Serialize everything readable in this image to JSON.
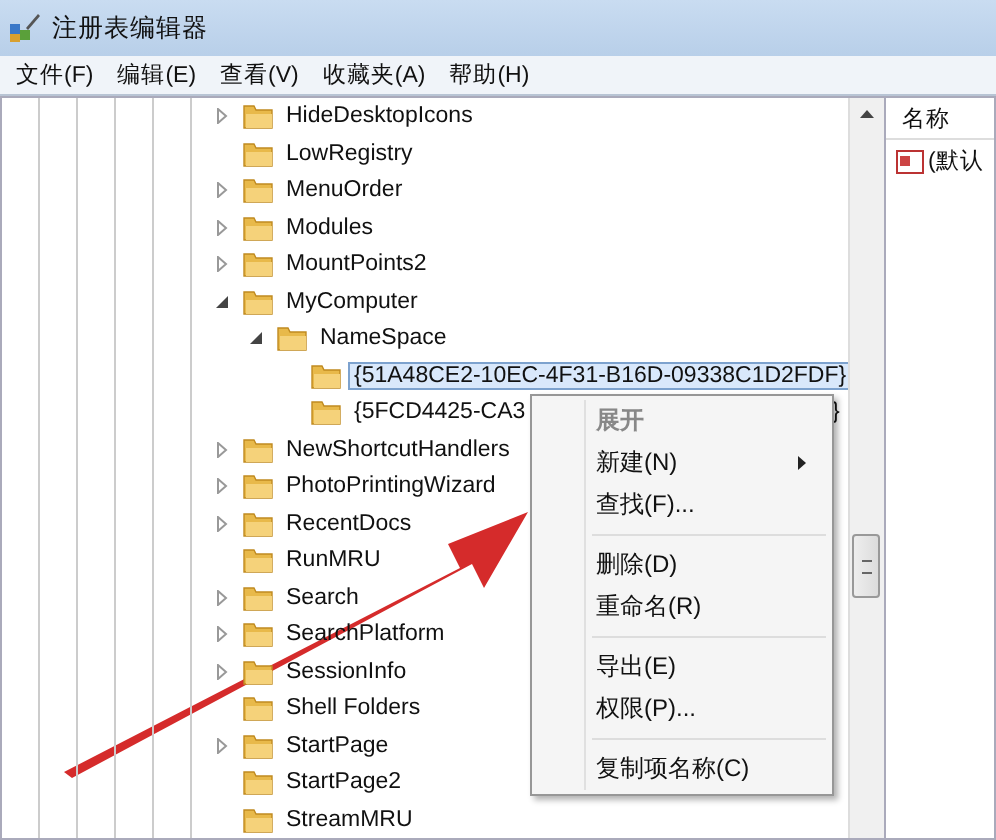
{
  "window": {
    "title": "注册表编辑器"
  },
  "menu_bar": [
    "文件(F)",
    "编辑(E)",
    "查看(V)",
    "收藏夹(A)",
    "帮助(H)"
  ],
  "tree": [
    {
      "label": "HideDesktopIcons",
      "expandable": true,
      "expanded": false,
      "selected": false
    },
    {
      "label": "LowRegistry",
      "expandable": false,
      "selected": false
    },
    {
      "label": "MenuOrder",
      "expandable": true,
      "expanded": false,
      "selected": false
    },
    {
      "label": "Modules",
      "expandable": true,
      "expanded": false,
      "selected": false
    },
    {
      "label": "MountPoints2",
      "expandable": true,
      "expanded": false,
      "selected": false
    },
    {
      "label": "MyComputer",
      "expandable": true,
      "expanded": true,
      "selected": false,
      "children": [
        {
          "label": "NameSpace",
          "expandable": true,
          "expanded": true,
          "selected": false,
          "children": [
            {
              "label": "{51A48CE2-10EC-4F31-B16D-09338C1D2FDF}",
              "expandable": false,
              "selected": true
            },
            {
              "label": "{5FCD4425-CA3",
              "tail": "}",
              "expandable": false,
              "selected": false
            }
          ]
        }
      ]
    },
    {
      "label": "NewShortcutHandlers",
      "expandable": true,
      "expanded": false,
      "selected": false
    },
    {
      "label": "PhotoPrintingWizard",
      "expandable": true,
      "expanded": false,
      "selected": false
    },
    {
      "label": "RecentDocs",
      "expandable": true,
      "expanded": false,
      "selected": false
    },
    {
      "label": "RunMRU",
      "expandable": false,
      "selected": false
    },
    {
      "label": "Search",
      "expandable": true,
      "expanded": false,
      "selected": false
    },
    {
      "label": "SearchPlatform",
      "expandable": true,
      "expanded": false,
      "selected": false
    },
    {
      "label": "SessionInfo",
      "expandable": true,
      "expanded": false,
      "selected": false
    },
    {
      "label": "Shell Folders",
      "expandable": false,
      "selected": false
    },
    {
      "label": "StartPage",
      "expandable": true,
      "expanded": false,
      "selected": false
    },
    {
      "label": "StartPage2",
      "expandable": false,
      "selected": false
    },
    {
      "label": "StreamMRU",
      "expandable": false,
      "selected": false
    }
  ],
  "values_pane": {
    "columns": [
      "名称"
    ],
    "rows": [
      {
        "name": "(默认"
      }
    ]
  },
  "context_menu": [
    {
      "kind": "item",
      "label": "展开",
      "default": true,
      "disabled": true,
      "submenu": false
    },
    {
      "kind": "item",
      "label": "新建(N)",
      "default": false,
      "disabled": false,
      "submenu": true
    },
    {
      "kind": "item",
      "label": "查找(F)...",
      "default": false,
      "disabled": false,
      "submenu": false
    },
    {
      "kind": "separator"
    },
    {
      "kind": "item",
      "label": "删除(D)",
      "default": false,
      "disabled": false,
      "submenu": false
    },
    {
      "kind": "item",
      "label": "重命名(R)",
      "default": false,
      "disabled": false,
      "submenu": false
    },
    {
      "kind": "separator"
    },
    {
      "kind": "item",
      "label": "导出(E)",
      "default": false,
      "disabled": false,
      "submenu": false
    },
    {
      "kind": "item",
      "label": "权限(P)...",
      "default": false,
      "disabled": false,
      "submenu": false
    },
    {
      "kind": "separator"
    },
    {
      "kind": "item",
      "label": "复制项名称(C)",
      "default": false,
      "disabled": false,
      "submenu": false
    }
  ]
}
